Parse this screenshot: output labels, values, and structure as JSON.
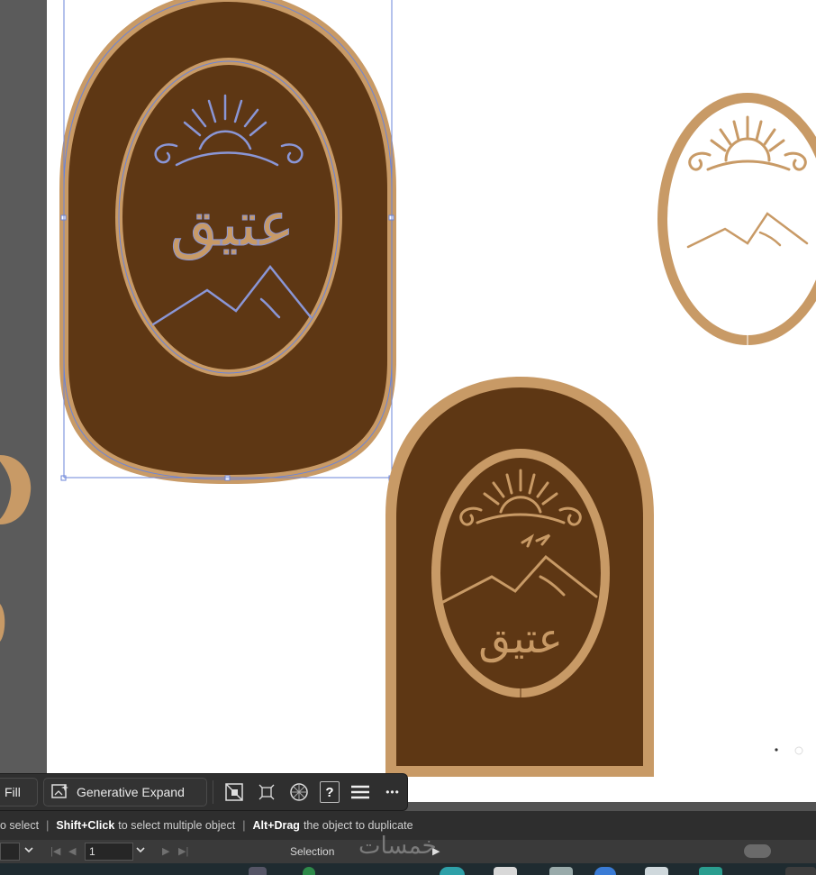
{
  "artwork": {
    "logo_text": "عتيق",
    "colors": {
      "dark_brown": "#5e3714",
      "tan": "#c89a66",
      "selection_blue": "#6b84d8",
      "pasteboard": "#5b5b5b",
      "artboard": "#ffffff"
    }
  },
  "context_bar": {
    "fill_label": "Fill",
    "generative_expand_label": "Generative Expand",
    "icons": [
      "generative-expand-icon",
      "mask-icon",
      "transform-icon",
      "recolor-icon",
      "help-icon",
      "menu-icon",
      "more-icon"
    ],
    "help_label": "?",
    "more_label": "•••"
  },
  "hint_bar": {
    "part1": "o select",
    "shift_click": "Shift+Click",
    "part2": "to select multiple object",
    "alt_drag": "Alt+Drag",
    "part3": "the object to duplicate"
  },
  "status_bar": {
    "artboard_number": "1",
    "tool_label": "Selection"
  },
  "watermark": "خمسات"
}
